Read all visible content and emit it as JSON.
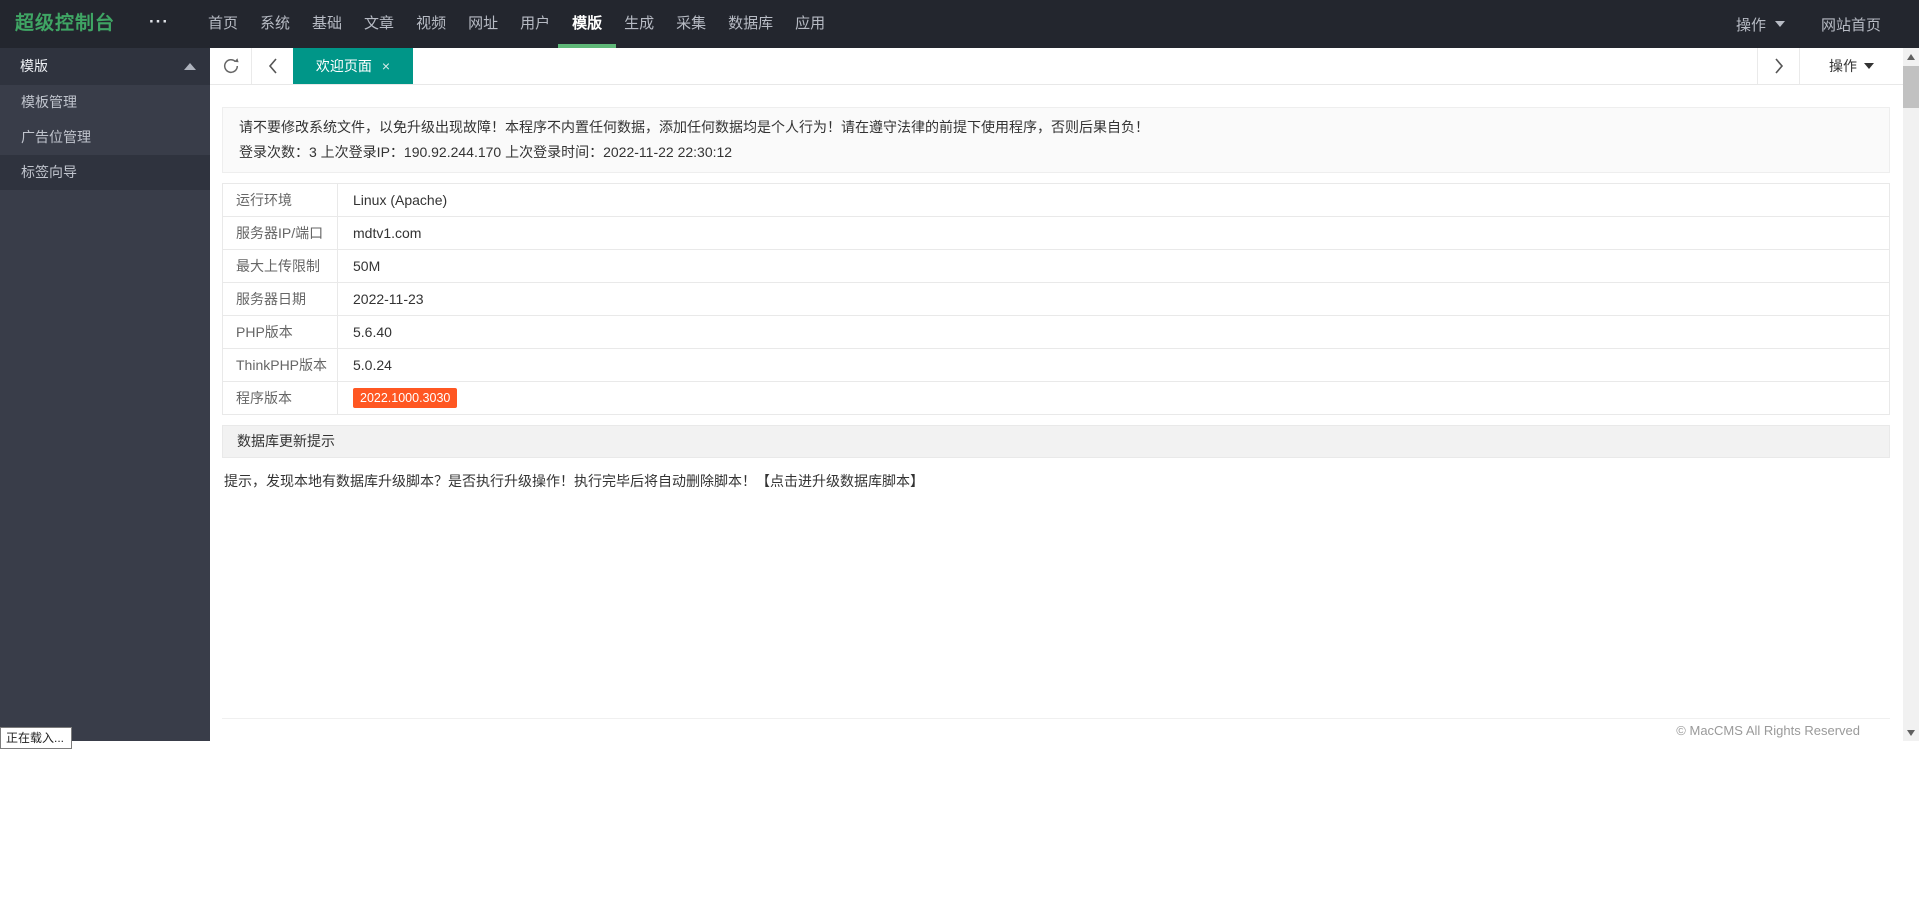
{
  "colors": {
    "navbar_bg": "#23262E",
    "sidebar_bg": "#393D49",
    "logo_green": "#3FA564",
    "accent_green": "#5FB878",
    "tab_teal": "#009688",
    "badge_orange": "#FF5722"
  },
  "navbar": {
    "logo": "超级控制台",
    "more_icon": "···",
    "items": [
      {
        "label": "首页",
        "active": false
      },
      {
        "label": "系统",
        "active": false
      },
      {
        "label": "基础",
        "active": false
      },
      {
        "label": "文章",
        "active": false
      },
      {
        "label": "视频",
        "active": false
      },
      {
        "label": "网址",
        "active": false
      },
      {
        "label": "用户",
        "active": false
      },
      {
        "label": "模版",
        "active": true
      },
      {
        "label": "生成",
        "active": false
      },
      {
        "label": "采集",
        "active": false
      },
      {
        "label": "数据库",
        "active": false
      },
      {
        "label": "应用",
        "active": false
      }
    ],
    "right": {
      "action_label": "操作",
      "home_label": "网站首页"
    }
  },
  "sidebar": {
    "header": "模版",
    "items": [
      {
        "label": "模板管理",
        "active": false
      },
      {
        "label": "广告位管理",
        "active": false
      },
      {
        "label": "标签向导",
        "active": true
      }
    ]
  },
  "tabbar": {
    "tab_label": "欢迎页面",
    "close_icon": "×",
    "action_label": "操作"
  },
  "notice": {
    "line1": "请不要修改系统文件，以免升级出现故障！本程序不内置任何数据，添加任何数据均是个人行为！请在遵守法律的前提下使用程序，否则后果自负！",
    "line2": "登录次数：3 上次登录IP：190.92.244.170 上次登录时间：2022-11-22 22:30:12"
  },
  "info_table": {
    "rows": [
      {
        "label": "运行环境",
        "value": "Linux (Apache)",
        "badge": false
      },
      {
        "label": "服务器IP/端口",
        "value": "mdtv1.com",
        "badge": false
      },
      {
        "label": "最大上传限制",
        "value": "50M",
        "badge": false
      },
      {
        "label": "服务器日期",
        "value": "2022-11-23",
        "badge": false
      },
      {
        "label": "PHP版本",
        "value": "5.6.40",
        "badge": false
      },
      {
        "label": "ThinkPHP版本",
        "value": "5.0.24",
        "badge": false
      },
      {
        "label": "程序版本",
        "value": "2022.1000.3030",
        "badge": true
      }
    ]
  },
  "db_section": {
    "title": "数据库更新提示",
    "tip_text": "提示，发现本地有数据库升级脚本？是否执行升级操作！执行完毕后将自动删除脚本！",
    "tip_link": "【点击进升级数据库脚本】"
  },
  "footer": {
    "copyright": "© MacCMS All Rights Reserved"
  },
  "status_tooltip": {
    "text": "正在载入..."
  }
}
